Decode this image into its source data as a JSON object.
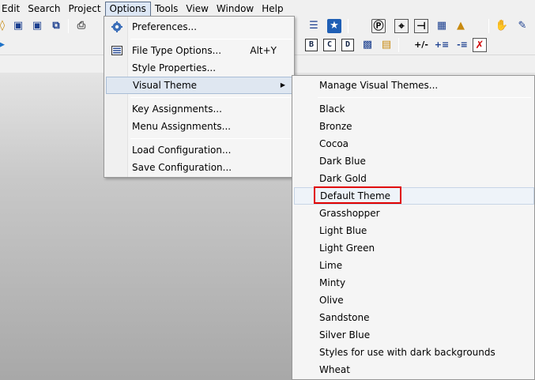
{
  "menubar": {
    "items": [
      "Edit",
      "Search",
      "Project",
      "Options",
      "Tools",
      "View",
      "Window",
      "Help"
    ],
    "active": "Options"
  },
  "toolbar": {
    "row2_letters": [
      "B",
      "C",
      "D"
    ],
    "row2_symbols": [
      "+/-",
      "+≡",
      "-≡"
    ]
  },
  "options_menu": {
    "preferences": "Preferences...",
    "file_type_options": "File Type Options...",
    "file_type_options_accel": "Alt+Y",
    "style_properties": "Style Properties...",
    "visual_theme": "Visual Theme",
    "key_assignments": "Key Assignments...",
    "menu_assignments": "Menu Assignments...",
    "load_configuration": "Load Configuration...",
    "save_configuration": "Save Configuration..."
  },
  "theme_menu": {
    "manage": "Manage Visual Themes...",
    "themes": [
      "Black",
      "Bronze",
      "Cocoa",
      "Dark Blue",
      "Dark Gold",
      "Default Theme",
      "Grasshopper",
      "Light Blue",
      "Light Green",
      "Lime",
      "Minty",
      "Olive",
      "Sandstone",
      "Silver Blue",
      "Styles for use with dark backgrounds",
      "Wheat"
    ],
    "selected": "Default Theme",
    "highlight_color": "#e00000"
  }
}
